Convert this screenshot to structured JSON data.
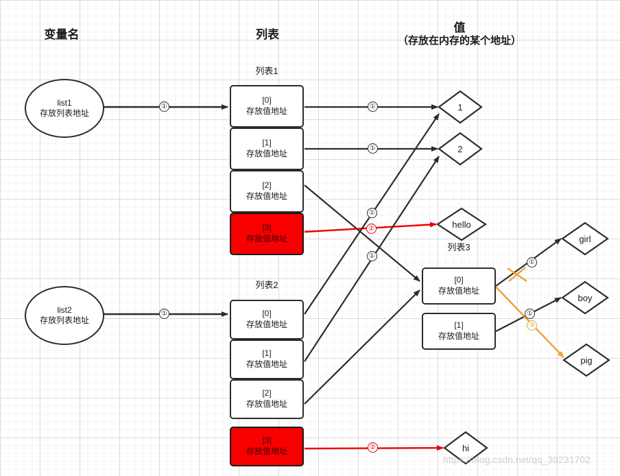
{
  "headers": {
    "variable_name": "变量名",
    "list": "列表",
    "value": "值",
    "value_sub": "（存放在内存的某个地址）"
  },
  "colors": {
    "stroke": "#2b2b2b",
    "red": "#f80000",
    "red_line": "#ef0000",
    "orange": "#f0a030",
    "box_bg": "#ffffff"
  },
  "variables": [
    {
      "name": "list1",
      "desc": "存放列表地址"
    },
    {
      "name": "list2",
      "desc": "存放列表地址"
    }
  ],
  "lists": [
    {
      "title": "列表1",
      "cells": [
        {
          "index": "[0]",
          "desc": "存放值地址",
          "highlight": false
        },
        {
          "index": "[1]",
          "desc": "存放值地址",
          "highlight": false
        },
        {
          "index": "[2]",
          "desc": "存放值地址",
          "highlight": false
        },
        {
          "index": "[3]",
          "desc": "存放值地址",
          "highlight": true
        }
      ]
    },
    {
      "title": "列表2",
      "cells": [
        {
          "index": "[0]",
          "desc": "存放值地址",
          "highlight": false
        },
        {
          "index": "[1]",
          "desc": "存放值地址",
          "highlight": false
        },
        {
          "index": "[2]",
          "desc": "存放值地址",
          "highlight": false
        },
        {
          "index": "[3]",
          "desc": "存放值地址",
          "highlight": true
        }
      ]
    },
    {
      "title": "列表3",
      "cells": [
        {
          "index": "[0]",
          "desc": "存放值地址",
          "highlight": false
        },
        {
          "index": "[1]",
          "desc": "存放值地址",
          "highlight": false
        }
      ]
    }
  ],
  "values": [
    {
      "label": "1"
    },
    {
      "label": "2"
    },
    {
      "label": "hello"
    },
    {
      "label": "girl"
    },
    {
      "label": "boy"
    },
    {
      "label": "pig"
    },
    {
      "label": "hi"
    }
  ],
  "badges": [
    {
      "text": "①",
      "color": "dark"
    },
    {
      "text": "①",
      "color": "dark"
    },
    {
      "text": "①",
      "color": "dark"
    },
    {
      "text": "①",
      "color": "dark"
    },
    {
      "text": "②",
      "color": "red"
    },
    {
      "text": "①",
      "color": "dark"
    },
    {
      "text": "①",
      "color": "dark"
    },
    {
      "text": "①",
      "color": "dark"
    },
    {
      "text": "①",
      "color": "dark"
    },
    {
      "text": "③",
      "color": "orange"
    },
    {
      "text": "②",
      "color": "red"
    }
  ],
  "watermark": "https://blog.csdn.net/qq_39231702"
}
